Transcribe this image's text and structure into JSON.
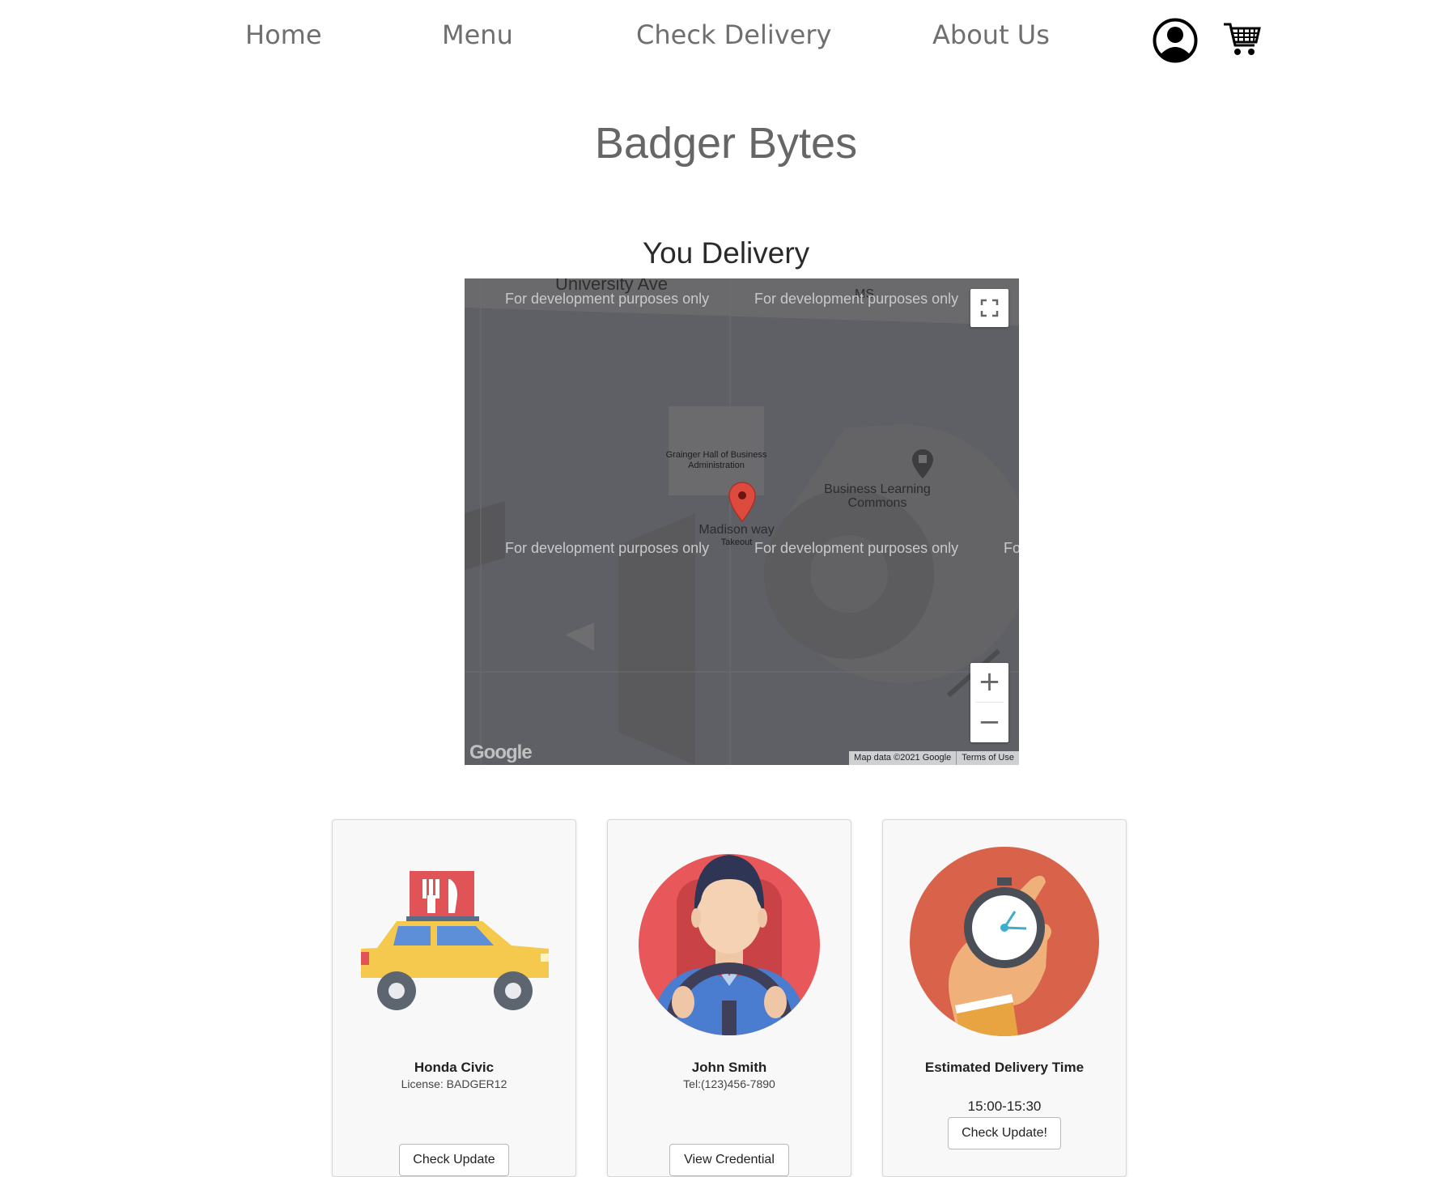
{
  "nav": {
    "items": [
      {
        "label": "Home"
      },
      {
        "label": "Menu"
      },
      {
        "label": "Check Delivery"
      },
      {
        "label": "About Us"
      }
    ]
  },
  "header": {
    "user_icon": "user-circle-icon",
    "cart_icon": "shopping-cart-icon"
  },
  "site": {
    "title": "Badger Bytes"
  },
  "section": {
    "title": "You Delivery"
  },
  "map": {
    "watermark": "For development purposes only",
    "watermark_clipped": "Fo",
    "streets": [
      "University Ave",
      "MS"
    ],
    "places": [
      {
        "name": "Grainger Hall of Business Administration"
      },
      {
        "name": "Business Learning Commons"
      },
      {
        "name": "Madison way"
      },
      {
        "name": "Takeout"
      }
    ],
    "logo": "Google",
    "attribution": "Map data ©2021 Google",
    "terms": "Terms of Use",
    "zoom_in": "+",
    "zoom_out": "−",
    "marker_color": "#dd4b3e",
    "bg_color": "#606063"
  },
  "cards": [
    {
      "icon": "delivery-car-icon",
      "title": "Honda Civic",
      "subtitle": "License: BADGER12",
      "button": "Check Update"
    },
    {
      "icon": "driver-icon",
      "title": "John Smith",
      "subtitle": "Tel:(123)456-7890",
      "button": "View Credential"
    },
    {
      "icon": "stopwatch-icon",
      "title": "Estimated Delivery Time",
      "time": "15:00-15:30",
      "button": "Check Update!"
    }
  ]
}
